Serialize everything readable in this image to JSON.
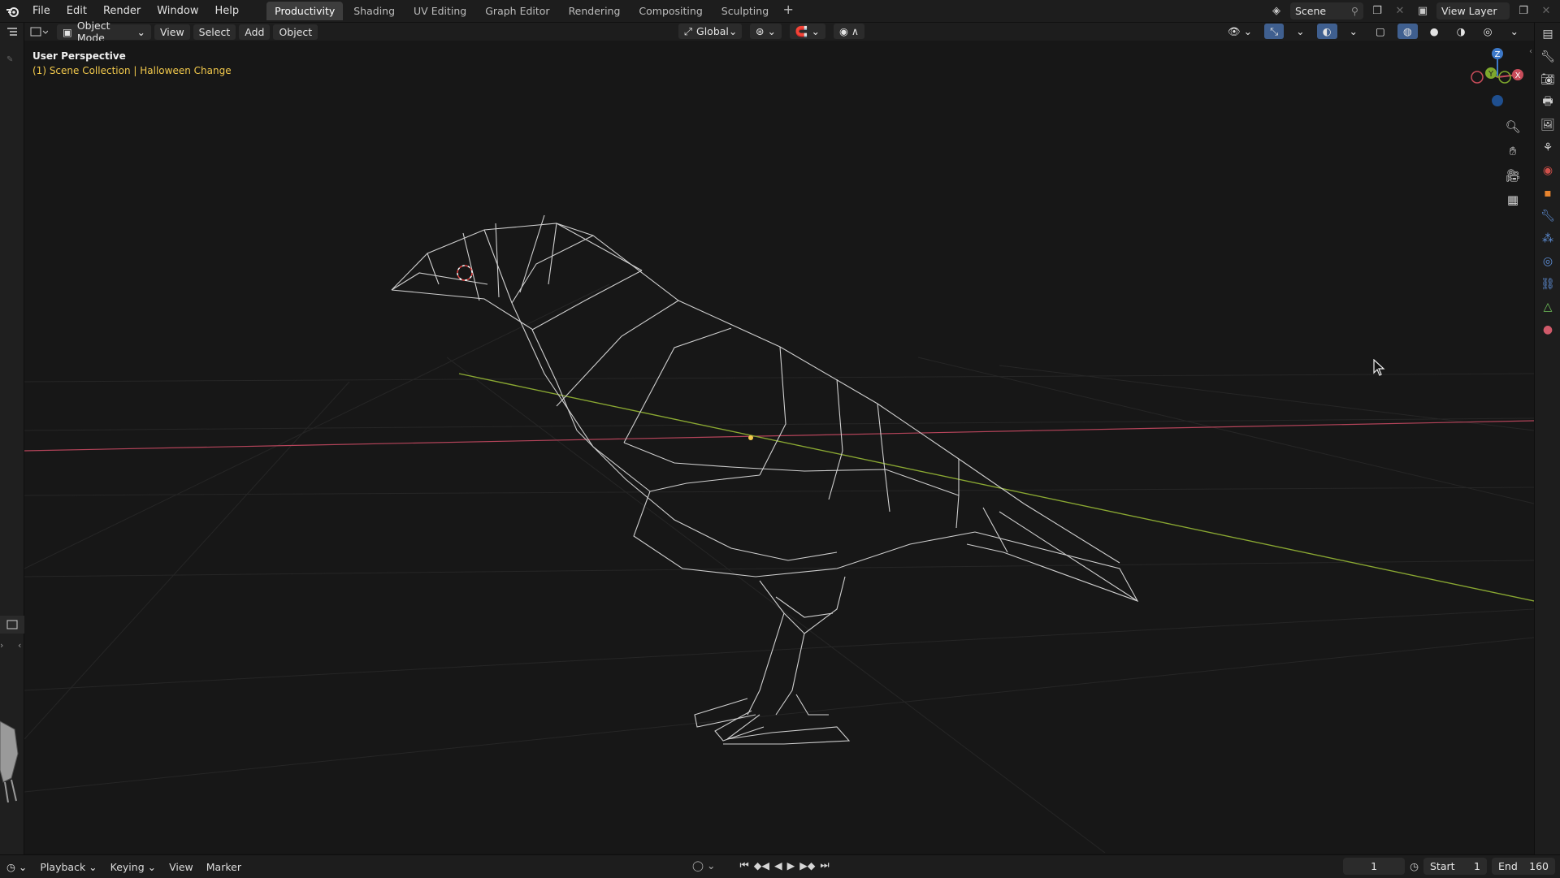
{
  "menu": {
    "items": [
      "File",
      "Edit",
      "Render",
      "Window",
      "Help"
    ]
  },
  "workspaces": {
    "tabs": [
      "Productivity",
      "Shading",
      "UV Editing",
      "Graph Editor",
      "Rendering",
      "Compositing",
      "Sculpting"
    ],
    "active": "Productivity",
    "add_label": "+"
  },
  "top_right": {
    "scene": "Scene",
    "view_layer": "View Layer"
  },
  "viewport_header": {
    "mode": "Object Mode",
    "menus": [
      "View",
      "Select",
      "Add",
      "Object"
    ],
    "orientation": "Global"
  },
  "viewport": {
    "title": "User Perspective",
    "subtitle": "(1) Scene Collection | Halloween Change",
    "gizmo_axes": [
      "Z",
      "Y",
      "X"
    ]
  },
  "timeline": {
    "menus": [
      "Playback",
      "Keying",
      "View",
      "Marker"
    ],
    "current_frame": "1",
    "start_label": "Start",
    "start_value": "1",
    "end_label": "End",
    "end_value": "160"
  },
  "colors": {
    "x_axis": "#b5445a",
    "y_axis": "#8aa832",
    "wire": "#cfcfcf",
    "active_tab_bg": "#3d3d3d",
    "subtitle": "#f2c94c"
  }
}
